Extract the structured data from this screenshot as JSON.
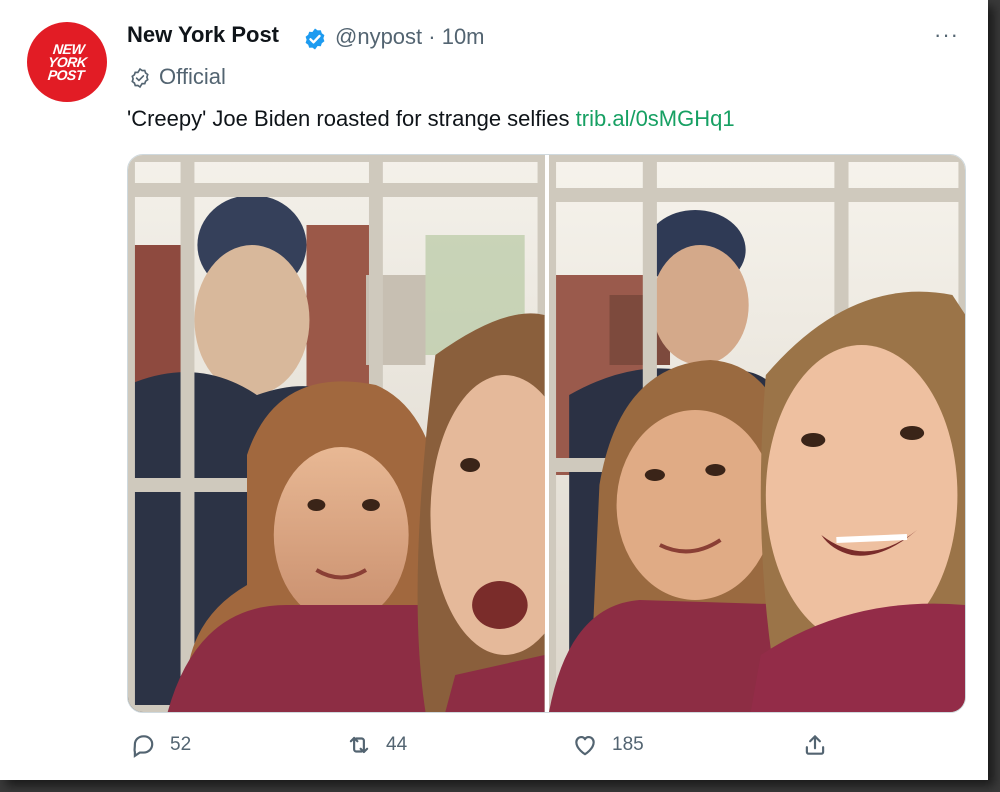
{
  "account": {
    "logo_text": "NEW YORK POST",
    "display_name": "New York Post",
    "handle_time": "@nypost · 10m",
    "label": "Official",
    "verified_color": "#1d9bf0",
    "avatar_color": "#e21c25"
  },
  "menu": {
    "more_label": "···"
  },
  "tweet": {
    "text": "'Creepy' Joe Biden roasted for strange selfies",
    "link": "trib.al/0sMGHq1"
  },
  "media": {
    "photos": [
      {
        "name": "selfie-photo-left"
      },
      {
        "name": "selfie-photo-right"
      }
    ]
  },
  "actions": {
    "reply": {
      "icon": "reply-icon",
      "count": "52"
    },
    "retweet": {
      "icon": "retweet-icon",
      "count": "44"
    },
    "like": {
      "icon": "heart-icon",
      "count": "185"
    },
    "share": {
      "icon": "share-icon"
    }
  }
}
